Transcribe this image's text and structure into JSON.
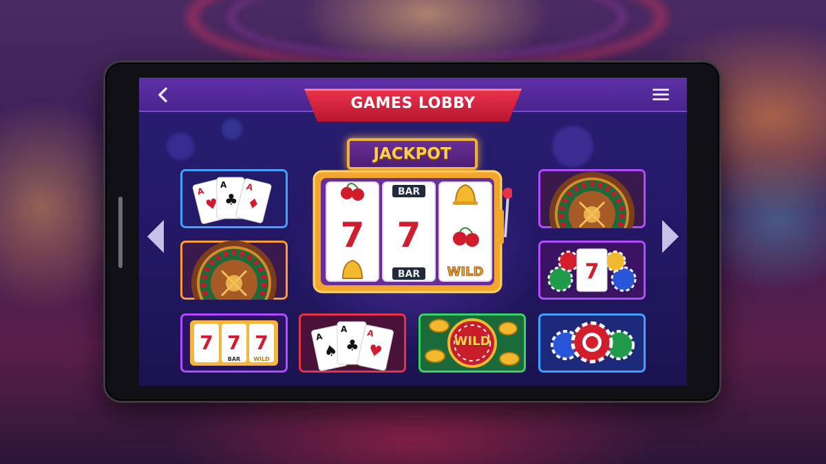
{
  "header": {
    "title": "GAMES LOBBY",
    "back_icon": "chevron-left-icon",
    "menu_icon": "hamburger-menu-icon"
  },
  "featured": {
    "sign": "JACKPOT",
    "reels": [
      [
        "cherry",
        "seven",
        "bell"
      ],
      [
        "BAR",
        "seven",
        "BAR"
      ],
      [
        "bell",
        "cherry",
        "WILD"
      ]
    ]
  },
  "tiles": {
    "cards_left": {
      "icon": "playing-cards-icon",
      "cards": [
        "A",
        "A",
        "A"
      ]
    },
    "roulette_left": {
      "icon": "roulette-wheel-icon"
    },
    "slots_777": {
      "icon": "slot-reels-icon",
      "symbols": [
        "7",
        "7",
        "7"
      ],
      "labels": [
        "BAR",
        "WILD"
      ]
    },
    "cards_bottom": {
      "icon": "playing-cards-icon",
      "cards": [
        "A",
        "A",
        "A"
      ]
    },
    "wild_coins": {
      "icon": "wild-coins-icon",
      "label": "WILD"
    },
    "chips_bottom": {
      "icon": "poker-chips-icon"
    },
    "roulette_right": {
      "icon": "roulette-wheel-icon"
    },
    "chips_seven": {
      "icon": "poker-chips-seven-icon",
      "symbol": "7"
    }
  },
  "navigation": {
    "prev_icon": "triangle-left-icon",
    "next_icon": "triangle-right-icon"
  },
  "colors": {
    "screen_bg": "#241866",
    "header_bg": "#5e2fa6",
    "ribbon": "#d22640",
    "gold": "#f2b23a",
    "tile_blue": "#3fa3ff",
    "tile_purple": "#b14cff",
    "tile_orange": "#ff9d2e",
    "tile_green": "#3ed16a"
  }
}
